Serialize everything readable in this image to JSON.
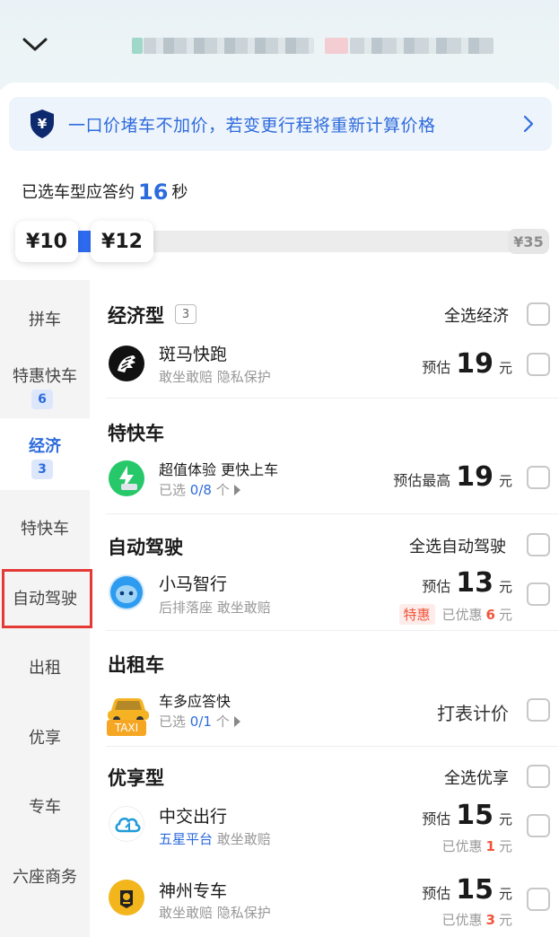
{
  "notice": {
    "text": "一口价堵车不加价，若变更行程将重新计算价格",
    "icon": "yuan-shield-icon",
    "accent_color": "#2d6bdc"
  },
  "answer_hint": {
    "prefix": "已选车型应答约",
    "seconds": "16",
    "suffix": "秒"
  },
  "price_slider": {
    "low": "¥10",
    "high": "¥12",
    "max": "¥35"
  },
  "sidebar": {
    "items": [
      {
        "label": "拼车"
      },
      {
        "label": "特惠快车",
        "badge": "6"
      },
      {
        "label": "经济",
        "badge": "3",
        "active": true
      },
      {
        "label": "特快车"
      },
      {
        "label": "自动驾驶",
        "highlighted": true
      },
      {
        "label": "出租"
      },
      {
        "label": "优享"
      },
      {
        "label": "专车"
      },
      {
        "label": "六座商务"
      }
    ]
  },
  "sections": {
    "economy": {
      "title": "经济型",
      "count": "3",
      "select_all": "全选经济",
      "items": [
        {
          "name": "斑马快跑",
          "sub": "敢坐敢赔 隐私保护",
          "price_label": "预估",
          "price": "19",
          "unit": "元",
          "icon": "zebra-logo-icon"
        }
      ]
    },
    "express": {
      "title": "特快车",
      "items": [
        {
          "name": "超值体验 更快上车",
          "sub_prefix": "已选 ",
          "sub_value": "0/8",
          "sub_suffix": " 个",
          "price_label": "预估最高",
          "price": "19",
          "unit": "元",
          "icon": "express-car-icon"
        }
      ]
    },
    "autonomous": {
      "title": "自动驾驶",
      "select_all": "全选自动驾驶",
      "items": [
        {
          "name": "小马智行",
          "sub": "后排落座 敢坐敢赔",
          "price_label": "预估",
          "price": "13",
          "unit": "元",
          "tag": "特惠",
          "discount_prefix": "已优惠",
          "discount_value": "6",
          "discount_unit": "元",
          "icon": "pony-robot-icon"
        }
      ]
    },
    "taxi": {
      "title": "出租车",
      "items": [
        {
          "name": "车多应答快",
          "sub_prefix": "已选 ",
          "sub_value": "0/1",
          "sub_suffix": " 个",
          "pricing": "打表计价",
          "icon": "taxi-icon",
          "icon_label": "TAXI"
        }
      ]
    },
    "premium": {
      "title": "优享型",
      "select_all": "全选优享",
      "items": [
        {
          "name": "中交出行",
          "sub_blue": "五星平台",
          "sub": "敢坐敢赔",
          "price_label": "预估",
          "price": "15",
          "unit": "元",
          "discount_prefix": "已优惠",
          "discount_value": "1",
          "discount_unit": "元",
          "icon": "cloud-logo-icon"
        },
        {
          "name": "神州专车",
          "sub": "敢坐敢赔 隐私保护",
          "price_label": "预估",
          "price": "15",
          "unit": "元",
          "discount_prefix": "已优惠",
          "discount_value": "3",
          "discount_unit": "元",
          "icon": "shenzhou-logo-icon"
        }
      ]
    }
  }
}
